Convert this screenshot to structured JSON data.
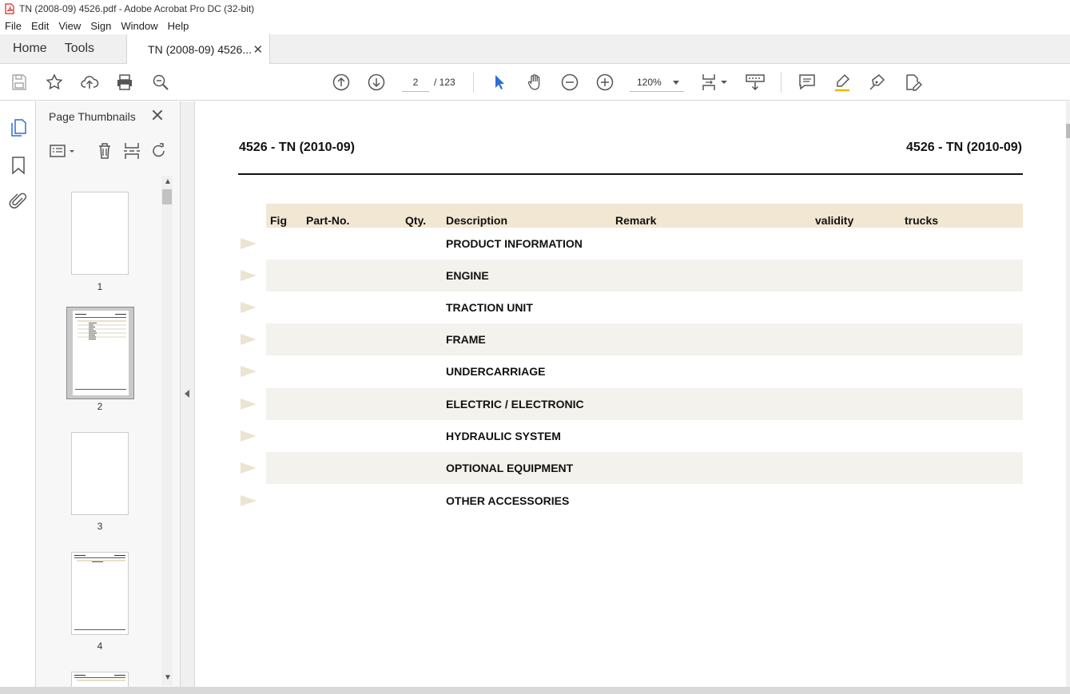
{
  "window": {
    "title": "TN (2008-09) 4526.pdf - Adobe Acrobat Pro DC (32-bit)"
  },
  "menu": [
    "File",
    "Edit",
    "View",
    "Sign",
    "Window",
    "Help"
  ],
  "tabs": {
    "home": "Home",
    "tools": "Tools",
    "document": "TN (2008-09) 4526..."
  },
  "toolbar": {
    "current_page": "2",
    "total_pages": "/ 123",
    "zoom": "120%"
  },
  "thumbnails": {
    "title": "Page Thumbnails",
    "pages": [
      {
        "number": "1"
      },
      {
        "number": "2",
        "selected": true
      },
      {
        "number": "3"
      },
      {
        "number": "4"
      }
    ]
  },
  "page": {
    "header_left": "4526 - TN (2010-09)",
    "header_right": "4526 - TN (2010-09)",
    "columns": [
      "Fig",
      "Part-No.",
      "Qty.",
      "Description",
      "Remark",
      "validity",
      "trucks"
    ],
    "rows": [
      "PRODUCT INFORMATION",
      "ENGINE",
      "TRACTION UNIT",
      "FRAME",
      "UNDERCARRIAGE",
      "ELECTRIC / ELECTRONIC",
      "HYDRAULIC SYSTEM",
      "OPTIONAL EQUIPMENT",
      "OTHER ACCESSORIES"
    ]
  },
  "colors": {
    "header_band": "#f1e7d3",
    "row_shade": "#f4f2ec",
    "selection_arrow": "#2b6ed6",
    "pdf_red": "#d7261e"
  }
}
